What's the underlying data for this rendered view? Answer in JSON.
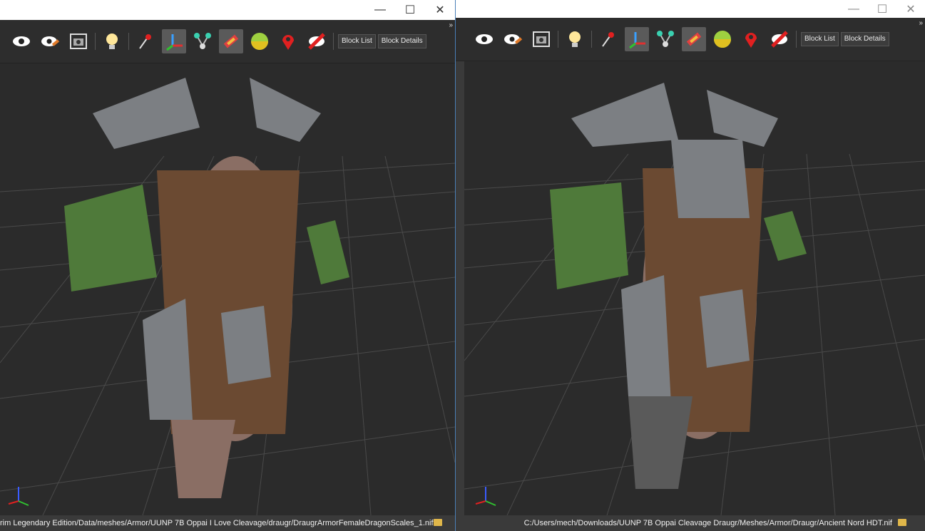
{
  "left_window": {
    "controls": {
      "minimize": "—",
      "maximize": "☐",
      "close": "✕"
    },
    "toolbar": {
      "block_list": "Block List",
      "block_details": "Block Details",
      "overflow": "»"
    },
    "status": {
      "path": "rim Legendary Edition/Data/meshes/Armor/UUNP 7B Oppai I Love Cleavage/draugr/DraugrArmorFemaleDragonScales_1.nif"
    }
  },
  "right_window": {
    "controls": {
      "minimize": "—",
      "maximize": "☐",
      "close": "✕"
    },
    "toolbar": {
      "block_list": "Block List",
      "block_details": "Block Details",
      "overflow": "»"
    },
    "status": {
      "path": "C:/Users/mech/Downloads/UUNP 7B Oppai Cleavage Draugr/Meshes/Armor/Draugr/Ancient Nord HDT.nif"
    }
  },
  "icons": [
    "eye-icon",
    "eye-edit-icon",
    "screenshot-icon",
    "light-bulb-icon",
    "pin-icon",
    "axes-tool-icon",
    "nodes-icon",
    "texture-icon",
    "color-wheel-icon",
    "location-icon",
    "no-eye-icon"
  ],
  "colors": {
    "viewport": "#2b2b2b",
    "grid": "#4a4a4a",
    "leather": "#6b4a32",
    "metal": "#7c7f83",
    "cloth": "#4f7a3a",
    "skin": "#8a6e64"
  }
}
